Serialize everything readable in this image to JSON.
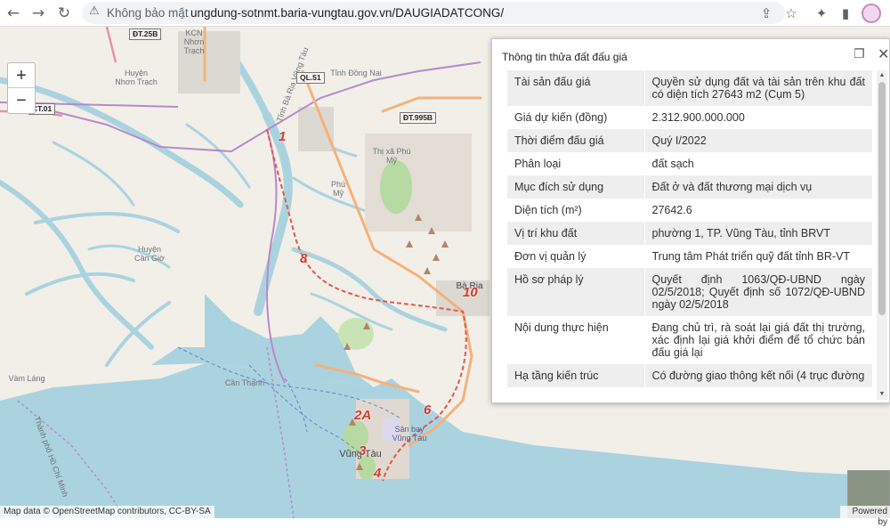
{
  "browser": {
    "back_icon": "arrow-left-icon",
    "forward_icon": "arrow-right-icon",
    "reload_icon": "reload-icon",
    "security_status": "Không bảo mật",
    "url": "ungdung-sotnmt.baria-vungtau.gov.vn/DAUGIADATCONG/",
    "toolbar_icons": [
      "share-icon",
      "star-icon",
      "extensions-icon",
      "sidebar-icon",
      "profile-avatar"
    ]
  },
  "map": {
    "zoom_in": "+",
    "zoom_out": "−",
    "attribution": "Map data © OpenStreetMap contributors, CC-BY-SA",
    "powered": "Powered by",
    "place_labels": [
      "KCN Nhơn\nTrạch",
      "Huyện\nNhơn Trạch",
      "Tỉnh Đồng Nai",
      "Tỉnh Bà Rịa Vũng Tàu",
      "Phú Mỹ",
      "Thị xã Phú\nMỹ",
      "Huyện\nCần Giờ",
      "Bà Rịa",
      "Cần Thạnh",
      "Vàm Láng",
      "Sân bay\nVũng Tàu",
      "Vũng Tàu",
      "Thành phố Hồ Chí Minh"
    ],
    "road_shields": [
      "ĐT.25B",
      "QL.51",
      "CT.01",
      "ĐT.995B"
    ],
    "route_numbers": [
      "1",
      "8",
      "10",
      "2A",
      "6",
      "3",
      "4"
    ],
    "colors": {
      "water": "#aad3df",
      "land": "#f2efe9",
      "road_major": "#f4b27a",
      "route_red": "#d33a2c"
    }
  },
  "popup": {
    "title": "Thông tin thửa đất đấu giá",
    "restore_icon": "restore-window-icon",
    "close_icon": "close-icon",
    "rows": [
      {
        "label": "Tài sản đấu giá",
        "value": "Quyền sử dụng đất và tài sản trên khu đất có diện tích 27643 m2 (Cụm 5)"
      },
      {
        "label": "Giá dự kiến (đồng)",
        "value": "2.312.900.000.000"
      },
      {
        "label": "Thời điểm đấu giá",
        "value": "Quý I/2022"
      },
      {
        "label": "Phân loại",
        "value": "đất sạch"
      },
      {
        "label": "Mục đích sử dụng",
        "value": "Đất ở và đất thương mại dịch vụ"
      },
      {
        "label": "Diện tích (m²)",
        "value": "27642.6"
      },
      {
        "label": "Vị trí khu đất",
        "value": "phường 1, TP. Vũng Tàu, tỉnh BRVT"
      },
      {
        "label": "Đơn vị quản lý",
        "value": "Trung tâm Phát triển quỹ đất tỉnh BR-VT"
      },
      {
        "label": "Hồ sơ pháp lý",
        "value": "Quyết định 1063/QĐ-UBND ngày 02/5/2018; Quyết định số 1072/QĐ-UBND ngày 02/5/2018"
      },
      {
        "label": "Nội dung thực hiện",
        "value": "Đang chủ trì, rà soát lại giá đất thị trường, xác định lại giá khởi điểm để tổ chức bán đấu giá lại"
      },
      {
        "label": "Hạ tầng kiến trúc",
        "value": "Có đường giao thông kết nối (4 trục đường"
      }
    ]
  }
}
